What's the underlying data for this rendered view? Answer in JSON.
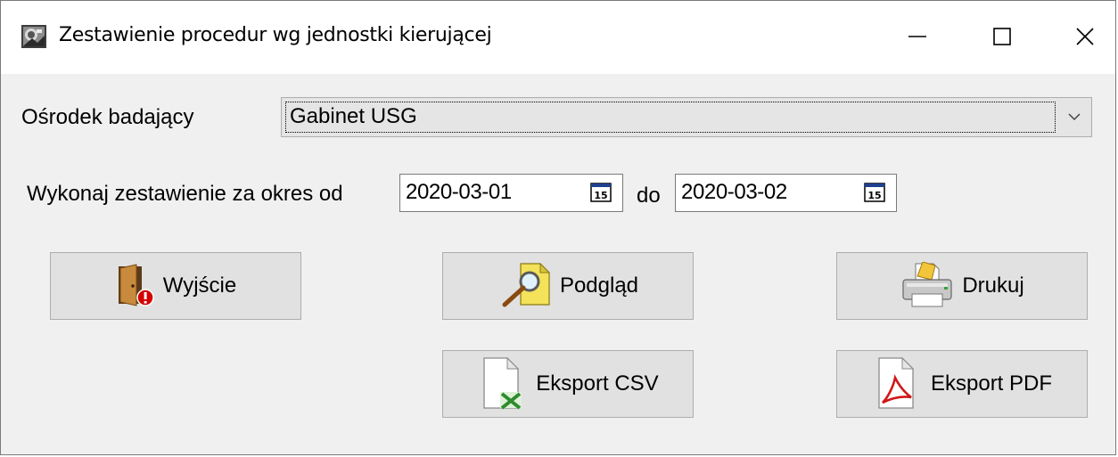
{
  "window": {
    "title": "Zestawienie procedur wg jednostki kierującej",
    "icon": "app-icon",
    "controls": [
      "minimize-icon",
      "maximize-icon",
      "close-icon"
    ]
  },
  "center": {
    "label": "Ośrodek badający",
    "selected": "Gabinet USG"
  },
  "period": {
    "label": "Wykonaj zestawienie za okres od",
    "from": "2020-03-01",
    "to_label": "do",
    "to": "2020-03-02",
    "calendar_icon_text": "15"
  },
  "buttons": {
    "exit": "Wyjście",
    "preview": "Podgląd",
    "print": "Drukuj",
    "export_csv": "Eksport CSV",
    "export_pdf": "Eksport PDF"
  },
  "colors": {
    "window_bg": "#f0f0f0",
    "button_bg": "#e1e1e1",
    "combo_bg": "#e5e5e5"
  }
}
